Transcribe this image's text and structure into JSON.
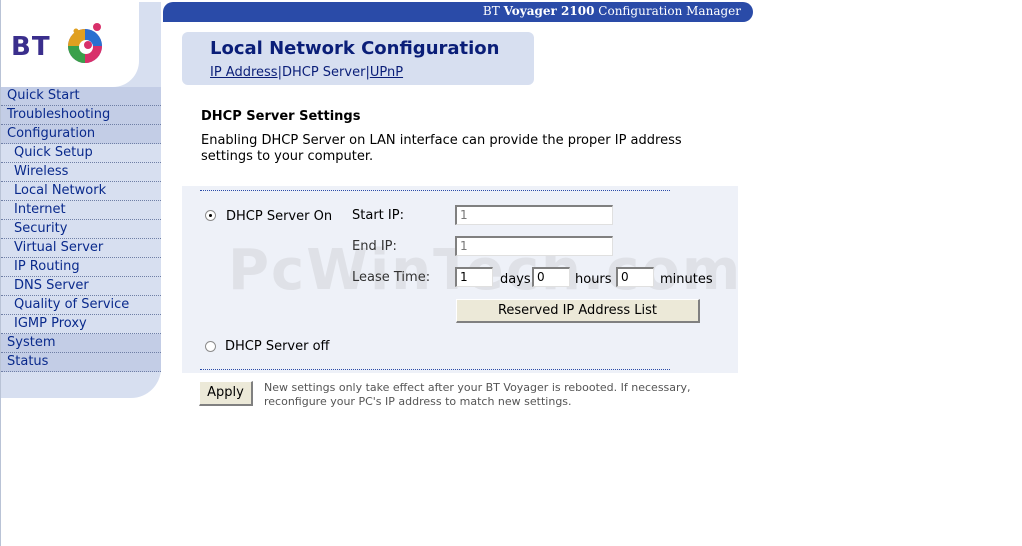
{
  "banner": {
    "brand": "BT",
    "product": "Voyager 2100",
    "suffix": "Configuration Manager"
  },
  "logo": {
    "text": "BT"
  },
  "nav": {
    "items": [
      {
        "label": "Quick Start",
        "sub": false
      },
      {
        "label": "Troubleshooting",
        "sub": false
      },
      {
        "label": "Configuration",
        "sub": false
      },
      {
        "label": "Quick Setup",
        "sub": true
      },
      {
        "label": "Wireless",
        "sub": true
      },
      {
        "label": "Local Network",
        "sub": true
      },
      {
        "label": "Internet",
        "sub": true
      },
      {
        "label": "Security",
        "sub": true
      },
      {
        "label": "Virtual Server",
        "sub": true
      },
      {
        "label": "IP Routing",
        "sub": true
      },
      {
        "label": "DNS Server",
        "sub": true
      },
      {
        "label": "Quality of Service",
        "sub": true
      },
      {
        "label": "IGMP Proxy",
        "sub": true
      },
      {
        "label": "System",
        "sub": false
      },
      {
        "label": "Status",
        "sub": false
      }
    ]
  },
  "header": {
    "title": "Local Network Configuration",
    "tabs": {
      "ip_address": "IP Address",
      "dhcp_server": "DHCP Server",
      "upnp": "UPnP"
    }
  },
  "section": {
    "title": "DHCP Server Settings",
    "description": "Enabling DHCP Server on LAN interface can provide the proper IP address settings to your computer."
  },
  "dhcp": {
    "on_label": "DHCP Server On",
    "off_label": "DHCP Server off",
    "selected": "on",
    "start_ip_label": "Start IP:",
    "start_ip_value": "1",
    "end_ip_label": "End IP:",
    "end_ip_value": "1",
    "lease_label": "Lease Time:",
    "lease_days": "1",
    "days_label": "days",
    "lease_hours": "0",
    "hours_label": "hours",
    "lease_minutes": "0",
    "minutes_label": "minutes",
    "reserved_button": "Reserved IP Address List"
  },
  "apply_button": "Apply",
  "note": "New settings only take effect after your BT Voyager is rebooted. If necessary, reconfigure your PC's IP address to match new settings.",
  "watermark": "PcWinTech.com",
  "colors": {
    "banner": "#2a4ba8",
    "nav_bg": "#d7dff0",
    "title": "#0a1e78",
    "link": "#0a2a8c"
  }
}
